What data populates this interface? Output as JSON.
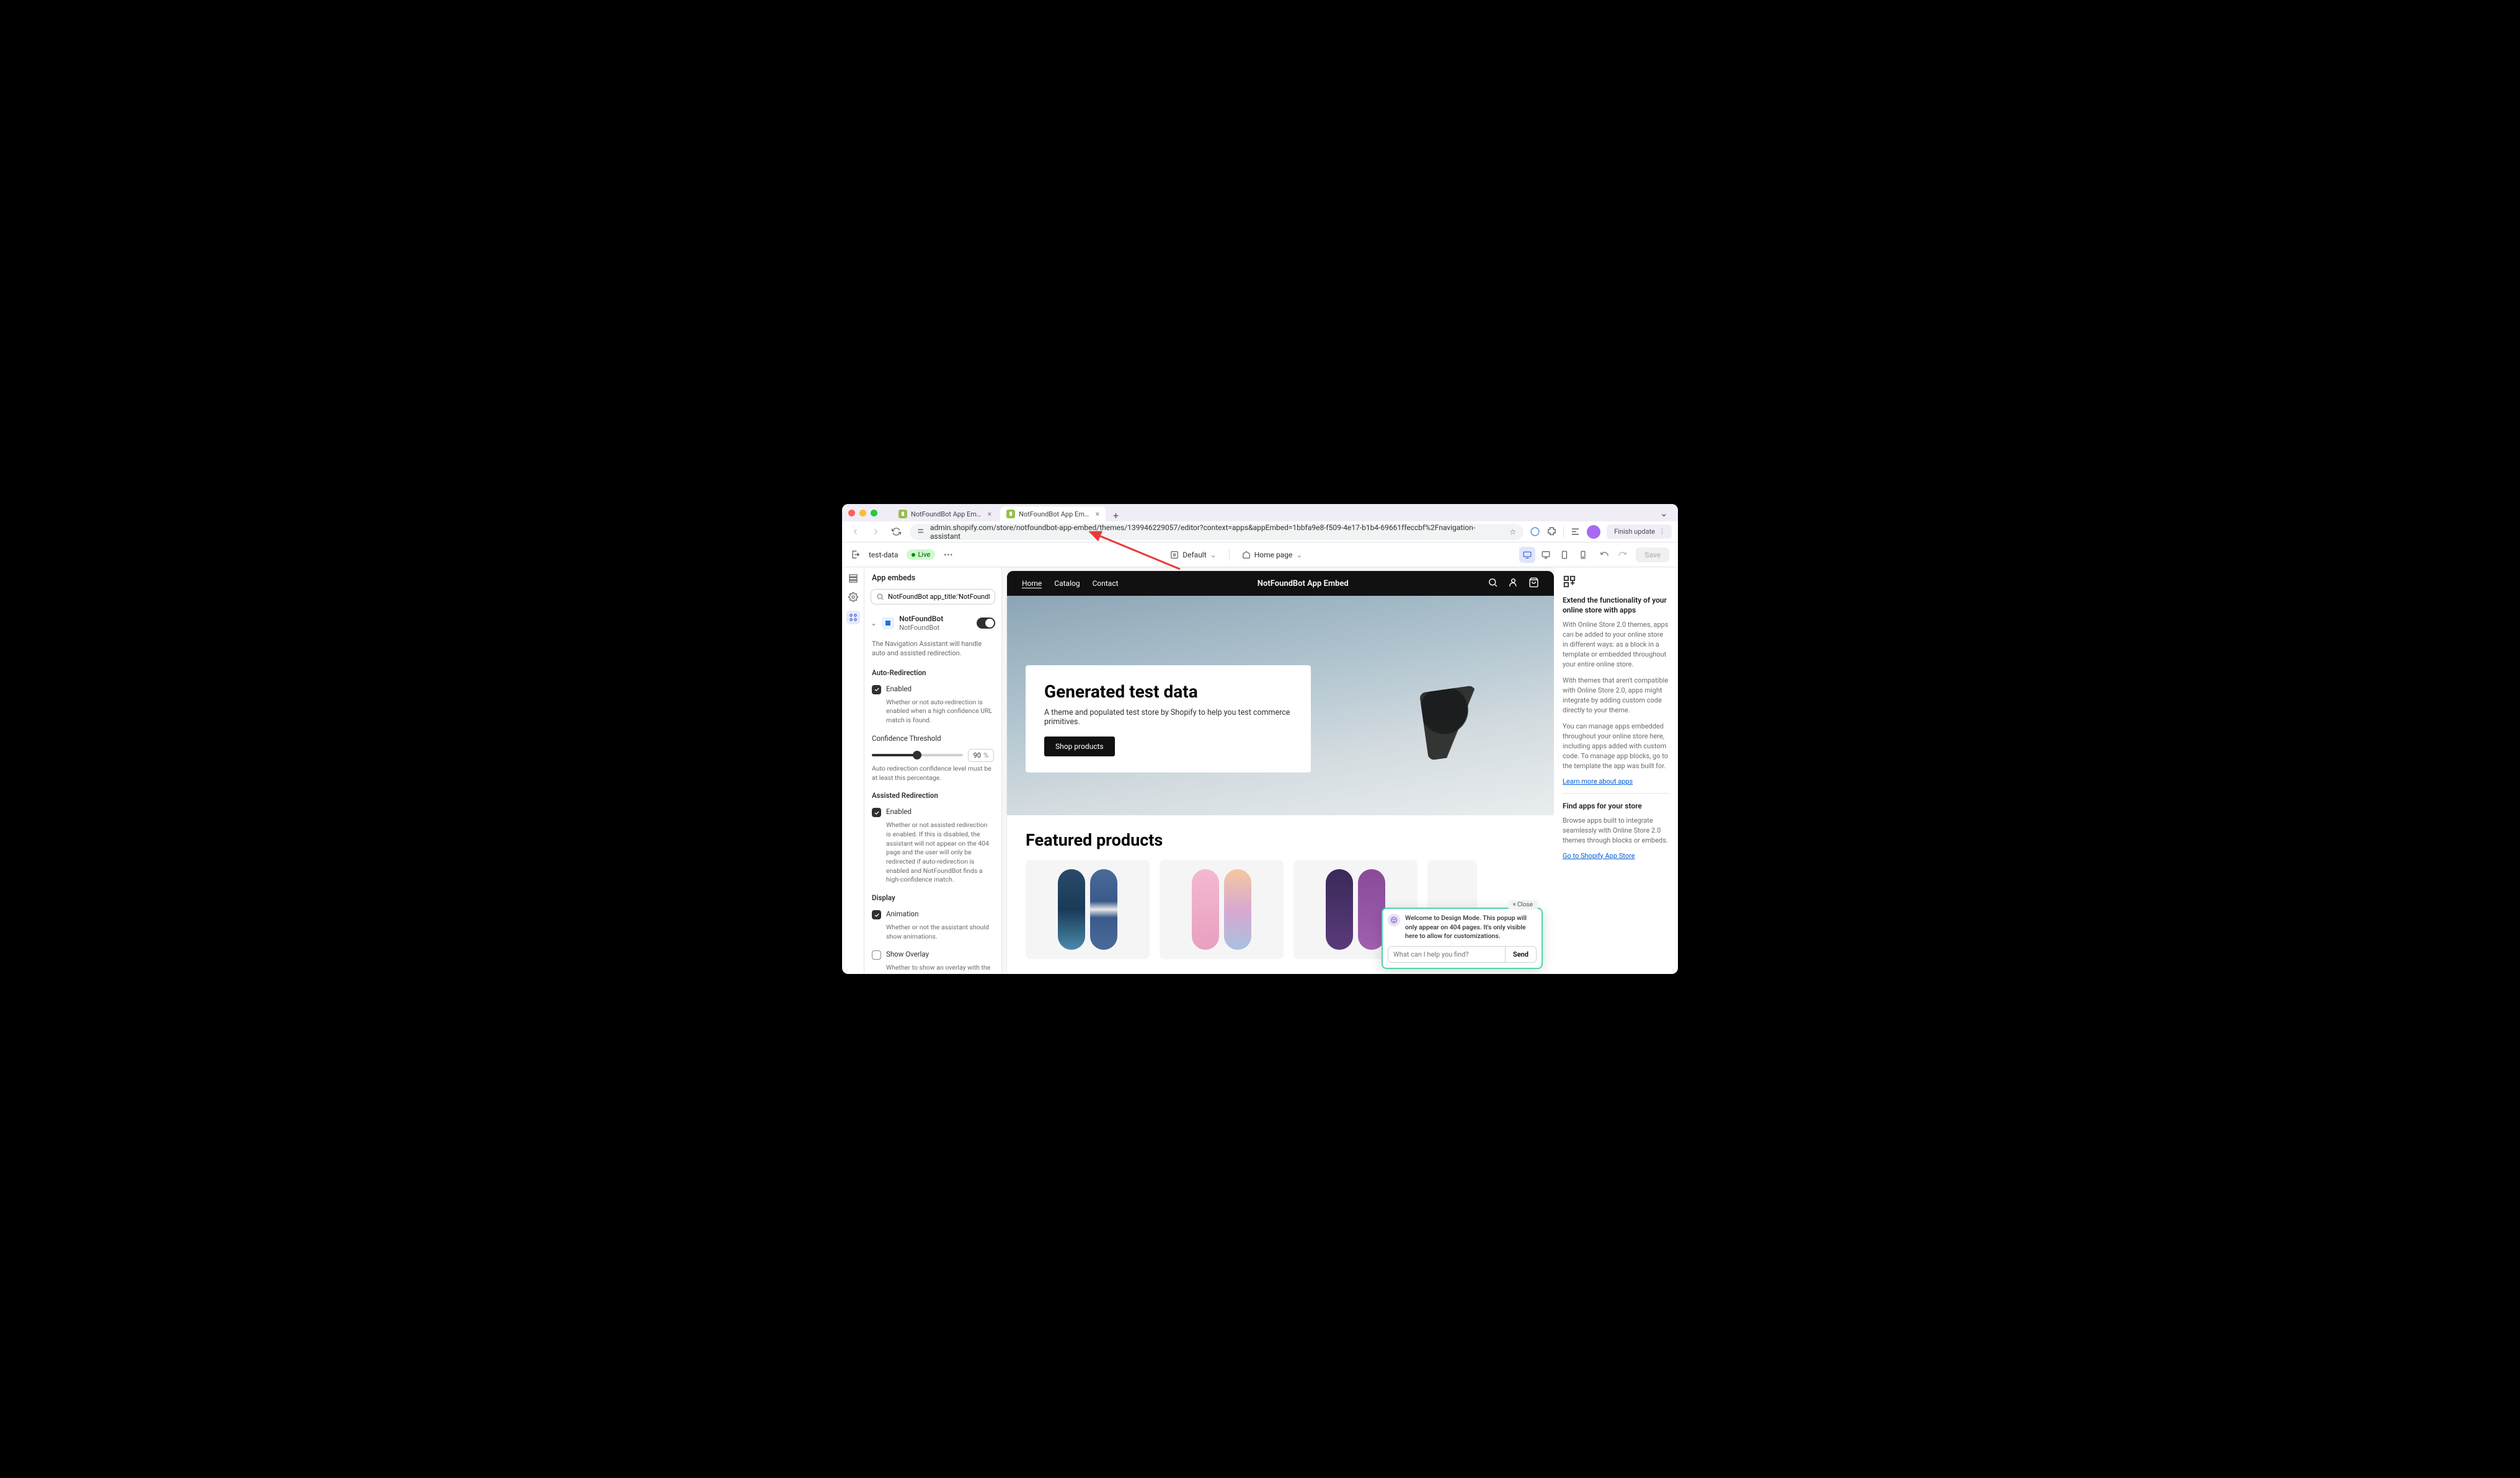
{
  "browser": {
    "tabs": [
      {
        "title": "NotFoundBot App Embed · N…",
        "active": false
      },
      {
        "title": "NotFoundBot App Embed · C…",
        "active": true
      }
    ],
    "url": "admin.shopify.com/store/notfoundbot-app-embed/themes/139946229057/editor?context=apps&appEmbed=1bbfa9e8-f509-4e17-b1b4-69661ffeccbf%2Fnavigation-assistant",
    "finish_update": "Finish update"
  },
  "toolbar": {
    "store": "test-data",
    "live": "Live",
    "template": "Default",
    "page": "Home page",
    "save": "Save"
  },
  "left": {
    "title": "App embeds",
    "search_value": "NotFoundBot app_title:'NotFoundBo",
    "app_name": "NotFoundBot",
    "app_vendor": "NotFoundBot",
    "description": "The Navigation Assistant will handle auto and assisted redirection.",
    "auto_redir": {
      "heading": "Auto-Redirection",
      "enabled": "Enabled",
      "desc": "Whether or not auto-redirection is enabled when a high confidence URL match is found."
    },
    "threshold": {
      "label": "Confidence Threshold",
      "value": "90",
      "unit": "%",
      "desc": "Auto redirection confidence level must be at least this percentage."
    },
    "assisted": {
      "heading": "Assisted Redirection",
      "enabled": "Enabled",
      "desc": "Whether or not assisted redirection is enabled. If this is disabled, the assistant will not appear on the 404 page and the user will only be redirected if auto-redirection is enabled and NotFoundBot finds a high-confidence match."
    },
    "display": {
      "heading": "Display",
      "animation": "Animation",
      "animation_desc": "Whether or not the assistant should show animations.",
      "overlay": "Show Overlay",
      "overlay_desc": "Whether to show an overlay with the assistant. If the user closes the"
    }
  },
  "site": {
    "nav": [
      "Home",
      "Catalog",
      "Contact"
    ],
    "brand": "NotFoundBot App Embed",
    "hero": {
      "title": "Generated test data",
      "desc": "A theme and populated test store by Shopify to help you test commerce primitives.",
      "cta": "Shop products"
    },
    "featured": "Featured products"
  },
  "right": {
    "h1": "Extend the functionality of your online store with apps",
    "p1": "With Online Store 2.0 themes, apps can be added to your online store in different ways: as a block in a template or embedded throughout your entire online store.",
    "p2": "With themes that aren't compatible with Online Store 2.0, apps might integrate by adding custom code directly to your theme.",
    "p3": "You can manage apps embedded throughout your online store here, including apps added with custom code. To manage app blocks, go to the template the app was built for.",
    "link1": "Learn more about apps",
    "h2": "Find apps for your store",
    "p4": "Browse apps built to integrate seamlessly with Online Store 2.0 themes through blocks or embeds.",
    "link2": "Go to Shopify App Store"
  },
  "chat": {
    "close": "Close",
    "msg": "Welcome to Design Mode. This popup will only appear on 404 pages. It's only visible here to allow for customizations.",
    "placeholder": "What can I help you find?",
    "send": "Send"
  },
  "colors": {
    "red": "#ff5f57",
    "yellow": "#febc2e",
    "green": "#28c840"
  }
}
